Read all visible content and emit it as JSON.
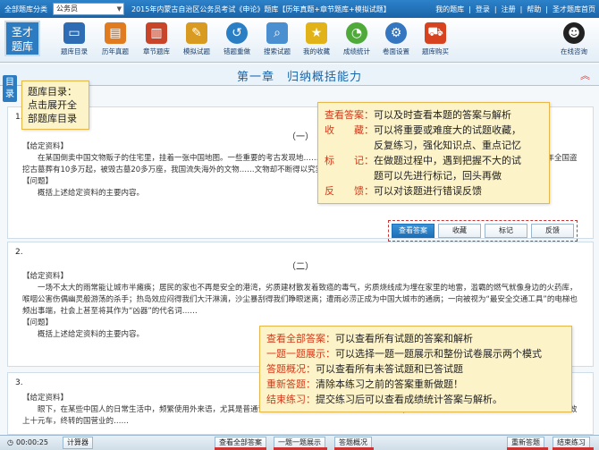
{
  "topbar": {
    "category_label": "全部题库分类",
    "category_value": "公务员",
    "breadcrumb": "2015年内蒙古自治区公务员考试《申论》题库【历年真题+章节题库+模拟试题】",
    "links": [
      "我的题库",
      "登录",
      "注册",
      "帮助",
      "圣才题库首页"
    ]
  },
  "toolbar": {
    "logo_line1": "圣才",
    "logo_line2": "题库",
    "buttons": [
      {
        "label": "题库目录",
        "icon": "monitor-icon",
        "color": "#2e6db3"
      },
      {
        "label": "历年真题",
        "icon": "book-icon",
        "color": "#e07b1f"
      },
      {
        "label": "章节题库",
        "icon": "chapter-icon",
        "color": "#c9452a"
      },
      {
        "label": "模拟试题",
        "icon": "pencil-icon",
        "color": "#d99a22"
      },
      {
        "label": "错题重做",
        "icon": "redo-icon",
        "color": "#2a7fc4"
      },
      {
        "label": "搜索试题",
        "icon": "search-icon",
        "color": "#4a8fd0"
      },
      {
        "label": "我的收藏",
        "icon": "star-icon",
        "color": "#e2b219"
      },
      {
        "label": "成绩统计",
        "icon": "chart-icon",
        "color": "#4faa3a"
      },
      {
        "label": "卷面设置",
        "icon": "gear-icon",
        "color": "#3576c0"
      },
      {
        "label": "题库购买",
        "icon": "cart-icon",
        "color": "#d8431f"
      }
    ],
    "online_label": "在线咨询"
  },
  "chapter_title": "第一章　归纳概括能力",
  "side_tab": "目录",
  "tips": {
    "catalog": [
      "题库目录：",
      "点击展开全",
      "部题库目录"
    ],
    "question_tools": [
      {
        "key": "查看答案：",
        "text": "可以及时查看本题的答案与解析"
      },
      {
        "key": "收　　藏：",
        "text": "可以将重要或难度大的试题收藏，"
      },
      {
        "key": "",
        "text": "反复练习，强化知识点、重点记忆"
      },
      {
        "key": "标　　记：",
        "text": "在做题过程中，遇到把握不大的试"
      },
      {
        "key": "",
        "text": "题可以先进行标记，回头再做"
      },
      {
        "key": "反　　馈：",
        "text": "可以对该题进行错误反馈"
      }
    ],
    "bottom_tools": [
      {
        "key": "查看全部答案：",
        "text": "可以查看所有试题的答案和解析"
      },
      {
        "key": "一题一题展示：",
        "text": "可以选择一题一题展示和整份试卷展示两个模式"
      },
      {
        "key": "答题概况：",
        "text": "可以查看所有未答试题和已答试题"
      },
      {
        "key": "重新答题：",
        "text": "清除本练习之前的答案重新做题！"
      },
      {
        "key": "结束练习：",
        "text": "提交练习后可以查看成绩统计答案与解析。"
      }
    ]
  },
  "questions": [
    {
      "num": "1.",
      "title": "（一）",
      "given": "【给定资料】",
      "body": "在某国倒卖中国文物贩子的住宅里，挂着一张中国地图。一些重要的考古发现地……（部分内容被提示框遮挡）……个以贩卖文物已经形成了行业。近几年全国盗挖古墓葬有10多万起，被毁古墓20多万座，我国流失海外的文物……文物却不断得以究实。",
      "question_label": "【问题】",
      "question": "概括上述给定资料的主要内容。"
    },
    {
      "num": "2.",
      "title": "（二）",
      "given": "【给定资料】",
      "body": "一场不太大的雨常能让城市半瘫痪；居民的家也不再是安全的港湾，劣质建材散发着致癌的毒气，劣质烧线成为埋在家里的地雷，滥霸的燃气就像身边的火药库，喉咽公害伤偶幽灵般游荡的杀手；热岛效应闷得我们大汗淋漓，沙尘暴刮得我们睁眼迷离；遭雨必涝正成为中国大城市的通病；一向被视为“最安全交通工具”的电梯也频出事端，社会上甚至将其作为“凶器”的代名词……",
      "question_label": "【问题】",
      "question": "概括上述给定资料的主要内容。"
    },
    {
      "num": "3.",
      "title": "（三）",
      "given": "【给定资料】",
      "body": "眼下，在某些中国人的日常生活中，频繁使用外来语，尤其是普通话夹杂英语单词，被认为是时尚的说话方式；一些国产商品的取名和说明书……任意进化的功效上十元车，终转的国营业的……",
      "question_label": "",
      "question": ""
    }
  ],
  "buttons": {
    "show_answer": "查看答案",
    "collect": "收藏",
    "mark": "标记",
    "feedback": "反馈"
  },
  "bottombar": {
    "timer": "00:00:25",
    "calculator": "计算器",
    "show_all": "查看全部答案",
    "one_by_one": "一题一题展示",
    "overview": "答题概况",
    "restart": "重新答题",
    "finish": "结束练习"
  }
}
